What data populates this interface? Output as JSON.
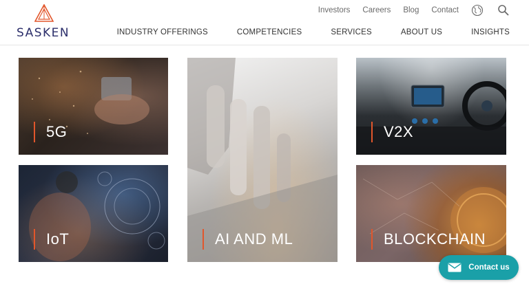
{
  "brand": {
    "name": "SASKEN",
    "accent": "#e2562b",
    "primary": "#2c2f6b"
  },
  "util_nav": [
    "Investors",
    "Careers",
    "Blog",
    "Contact"
  ],
  "util_icons": [
    "globe-icon",
    "search-icon"
  ],
  "main_nav": [
    "INDUSTRY OFFERINGS",
    "COMPETENCIES",
    "SERVICES",
    "ABOUT US",
    "INSIGHTS"
  ],
  "tiles": [
    {
      "label": "5G"
    },
    {
      "label": "IoT"
    },
    {
      "label": "AI AND ML"
    },
    {
      "label": "V2X"
    },
    {
      "label": "BLOCKCHAIN"
    }
  ],
  "contact": {
    "label": "Contact us",
    "color": "#1aa0a8"
  }
}
